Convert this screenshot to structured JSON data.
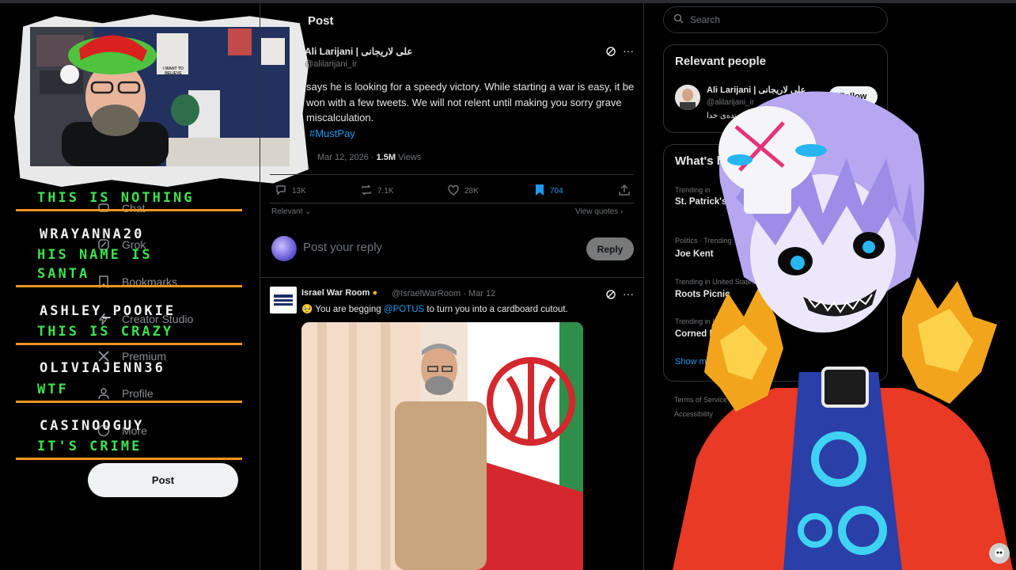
{
  "main": {
    "header_title": "Post",
    "post": {
      "author_name": "Ali Larijani | علی لاریجانی",
      "author_handle": "@alilarijani_ir",
      "text": "says he is looking for a speedy victory. While starting a war is easy, it be won with a few tweets. We will not relent until making you sorry grave miscalculation.",
      "hashtag": "#MustPay",
      "date": "Mar 12, 2026",
      "views_count": "1.5M",
      "views_label": "Views",
      "actions": {
        "replies": "13K",
        "reposts": "7.1K",
        "likes": "28K",
        "bookmarks": "704"
      }
    },
    "sort_label": "Relevant",
    "view_quotes": "View quotes",
    "reply_placeholder": "Post your reply",
    "reply_button": "Reply",
    "quote": {
      "author_name": "Israel War Room",
      "author_handle": "@IsraelWarRoom · Mar 12",
      "text_before": "You are begging",
      "mention": "@POTUS",
      "text_after": "to turn you into a cardboard cutout."
    }
  },
  "nav": {
    "items": [
      {
        "label": "Chat",
        "icon": "chat-icon"
      },
      {
        "label": "Grok",
        "icon": "grok-icon"
      },
      {
        "label": "Bookmarks",
        "icon": "bookmark-icon"
      },
      {
        "label": "Creator Studio",
        "icon": "bolt-icon"
      },
      {
        "label": "Premium",
        "icon": "x-logo-icon"
      },
      {
        "label": "Profile",
        "icon": "person-icon"
      },
      {
        "label": "More",
        "icon": "more-circle-icon"
      }
    ],
    "post_button": "Post"
  },
  "chat": {
    "messages": [
      {
        "user": "",
        "text": "THIS IS NOTHING"
      },
      {
        "user": "WRAYANNA20",
        "text": "HIS NAME IS SANTA"
      },
      {
        "user": "ASHLEY_POOKIE",
        "text": "THIS IS CRAZY"
      },
      {
        "user": "OLIVIAJENN36",
        "text": "WTF"
      },
      {
        "user": "CASINOOGUY",
        "text": "IT'S CRIME"
      }
    ],
    "accent_color": "#f7941d",
    "message_color": "#3ee34f"
  },
  "webcam": {
    "poster_text": "I WANT TO BELIEVE"
  },
  "right": {
    "search_placeholder": "Search",
    "relevant_people": {
      "title": "Relevant people",
      "name": "Ali Larijani | علی لاریجانی",
      "handle": "@alilarijani_ir",
      "bio": "بنده‌ی خدا",
      "follow": "Follow"
    },
    "trending": {
      "title": "What's happening",
      "items": [
        {
          "meta": "Trending in",
          "name": "St. Patrick's"
        },
        {
          "meta": "Politics · Trending",
          "name": "Joe Kent"
        },
        {
          "meta": "Trending in United States",
          "name": "Roots Picnic"
        },
        {
          "meta": "Trending in United States",
          "name": "Corned Beef"
        }
      ],
      "show_more": "Show more"
    },
    "footer": [
      "Terms of Service",
      "Accessibility"
    ]
  },
  "colors": {
    "link": "#1d9bf0",
    "bookmark_active": "#1d9bf0",
    "background": "#000000"
  }
}
